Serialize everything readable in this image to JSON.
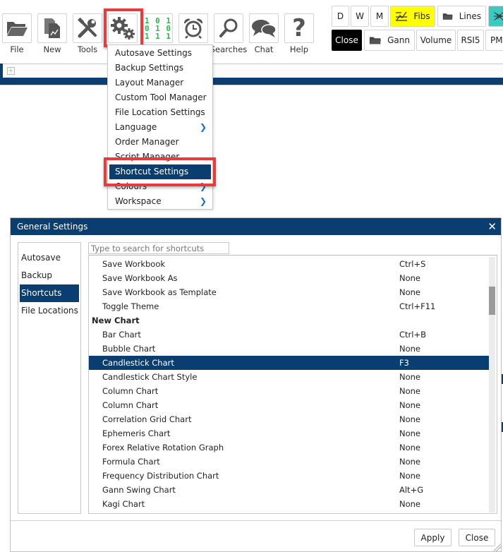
{
  "toolbar": {
    "buttons": [
      {
        "label": "File",
        "icon": "folder-open-icon"
      },
      {
        "label": "New",
        "icon": "new-chart-icon"
      },
      {
        "label": "Tools",
        "icon": "tools-icon"
      },
      {
        "label": "",
        "icon": "gears-icon"
      },
      {
        "label": "",
        "icon": "binary-icon",
        "glyph": [
          "1 0 1",
          "0 1 0",
          "1 1 1"
        ]
      },
      {
        "label": "",
        "icon": "alarm-clock-icon"
      },
      {
        "label": "Searches",
        "icon": "search-icon"
      },
      {
        "label": "Chat",
        "icon": "chat-bubbles-icon"
      },
      {
        "label": "Help",
        "icon": "help-question-icon",
        "glyph": "?"
      }
    ],
    "quick_buttons_row1": [
      {
        "label": "D"
      },
      {
        "label": "W"
      },
      {
        "label": "M"
      },
      {
        "label": "Fibs",
        "icon": "fibonacci-icon",
        "color": "#ffff00"
      },
      {
        "label": "Lines",
        "icon": "folder-icon"
      },
      {
        "label": "",
        "icon": "star-pattern-icon",
        "color": "#3ec9c0"
      }
    ],
    "quick_buttons_row2": [
      {
        "label": "Close",
        "color": "#000000"
      },
      {
        "label": "Gann",
        "icon": "folder-icon"
      },
      {
        "label": "Volume"
      },
      {
        "label": "RSI5"
      },
      {
        "label": "PM"
      }
    ]
  },
  "tabstrip": {
    "add_tab": "+"
  },
  "settings_menu": {
    "items": [
      {
        "label": "Autosave Settings",
        "submenu": false
      },
      {
        "label": "Backup Settings",
        "submenu": false
      },
      {
        "label": "Layout Manager",
        "submenu": false
      },
      {
        "label": "Custom Tool Manager",
        "submenu": false
      },
      {
        "label": "File Location Settings",
        "submenu": false
      },
      {
        "label": "Language",
        "submenu": true
      },
      {
        "label": "Order Manager",
        "submenu": false
      },
      {
        "label": "Script Manager",
        "submenu": false
      },
      {
        "label": "Shortcut Settings",
        "submenu": false,
        "active": true
      },
      {
        "label": "Colours",
        "submenu": true
      },
      {
        "label": "Workspace",
        "submenu": true
      }
    ],
    "chevron": "❯"
  },
  "dialog": {
    "title": "General Settings",
    "close_glyph": "✕",
    "nav": [
      {
        "label": "Autosave"
      },
      {
        "label": "Backup"
      },
      {
        "label": "Shortcuts",
        "active": true
      },
      {
        "label": "File Locations"
      }
    ],
    "search_placeholder": "Type to search for shortcuts",
    "shortcuts": [
      {
        "name": "Save Workbook",
        "key": "Ctrl+S"
      },
      {
        "name": "Save Workbook As",
        "key": "None"
      },
      {
        "name": "Save Workbook as Template",
        "key": "None"
      },
      {
        "name": "Toggle Theme",
        "key": "Ctrl+F11"
      },
      {
        "name": "New Chart",
        "key": "",
        "header": true
      },
      {
        "name": "Bar Chart",
        "key": "Ctrl+B"
      },
      {
        "name": "Bubble Chart",
        "key": "None"
      },
      {
        "name": "Candlestick Chart",
        "key": "F3",
        "selected": true
      },
      {
        "name": "Candlestick Chart Style",
        "key": "None"
      },
      {
        "name": "Column Chart",
        "key": "None"
      },
      {
        "name": "Column Chart",
        "key": "None"
      },
      {
        "name": "Correlation Grid Chart",
        "key": "None"
      },
      {
        "name": "Ephemeris Chart",
        "key": "None"
      },
      {
        "name": "Forex Relative Rotation Graph",
        "key": "None"
      },
      {
        "name": "Formula Chart",
        "key": "None"
      },
      {
        "name": "Frequency Distribution Chart",
        "key": "None"
      },
      {
        "name": "Gann Swing Chart",
        "key": "Alt+G"
      },
      {
        "name": "Kagi Chart",
        "key": "None"
      }
    ],
    "scroll_position": 0.13,
    "apply_label": "Apply",
    "close_label": "Close"
  }
}
